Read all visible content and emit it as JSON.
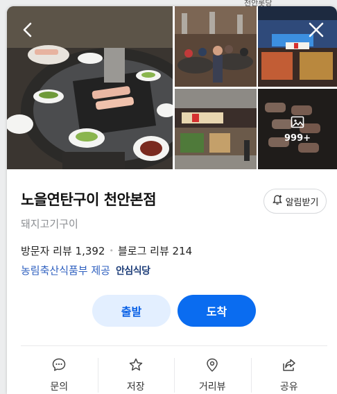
{
  "map": {
    "road_label": "천안롯당"
  },
  "gallery": {
    "photos": [
      {
        "name": "bbq-grill-table"
      },
      {
        "name": "restaurant-interior"
      },
      {
        "name": "night-storefront"
      },
      {
        "name": "building-exterior"
      },
      {
        "name": "grilled-meat"
      }
    ],
    "more_count": "999+"
  },
  "place": {
    "name": "노을연탄구이 천안본점",
    "category": "돼지고기구이",
    "visitor_reviews": "방문자 리뷰 1,392",
    "blog_reviews": "블로그 리뷰 214",
    "provider": "농림축산식품부 제공",
    "safe_badge": "안심식당"
  },
  "buttons": {
    "alarm": "알림받기",
    "depart": "출발",
    "arrive": "도착"
  },
  "actions": [
    {
      "label": "문의",
      "icon": "chat-icon"
    },
    {
      "label": "저장",
      "icon": "star-icon"
    },
    {
      "label": "거리뷰",
      "icon": "location-pin-icon"
    },
    {
      "label": "공유",
      "icon": "share-icon"
    }
  ],
  "colors": {
    "primary": "#0a6cf0",
    "primary_light": "#e3efff",
    "link": "#2d5fbf"
  }
}
